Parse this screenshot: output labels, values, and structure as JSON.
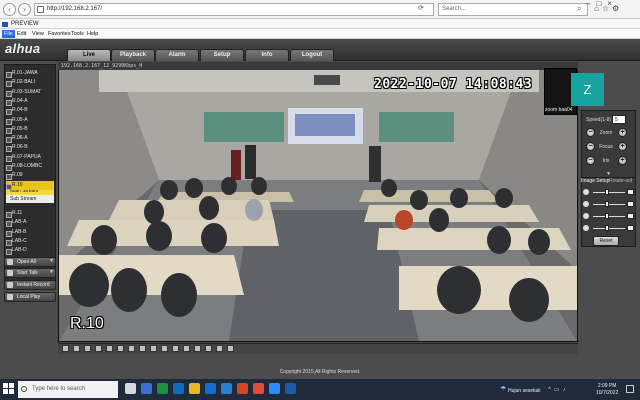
{
  "browser": {
    "url": "http://192.168.2.167/",
    "search_placeholder": "Search...",
    "tab_title": "PREVIEW",
    "menu": [
      "File",
      "Edit",
      "View",
      "Favorites",
      "Tools",
      "Help"
    ]
  },
  "app": {
    "logo": "alhua",
    "tabs": [
      "Live",
      "Playback",
      "Alarm",
      "Setup",
      "Info",
      "Logout"
    ],
    "active_tab": "Live"
  },
  "channels": [
    "R.01-JAWA",
    "R.02-BALI",
    "R.03-SUMAT",
    "R.04-A",
    "R.04-B",
    "R.05-A",
    "R.05-B",
    "R.06-A",
    "R.06-B",
    "R.07-PAPUA",
    "R.08-LOMBC",
    "R.09",
    "R.10",
    "R.11",
    "LAB-A",
    "LAB-B",
    "LAB-C",
    "LAB-D"
  ],
  "selected_channel": "R.10",
  "streams": {
    "main": "Main Stream",
    "sub": "Sub Stream"
  },
  "left_buttons": {
    "open_all": "Open All",
    "start_talk": "Start Talk",
    "instant_record": "Instant Record",
    "local_play": "Local Play"
  },
  "video": {
    "info_bar": "192.168.2.167_12_9290Kbps_H",
    "timestamp": "2022-10-07 14:08:43",
    "channel_label": "R.10"
  },
  "zoom_overlay": {
    "initial": "Z",
    "name": "zoom baa04"
  },
  "ptz": {
    "speed_label": "Speed(1-8)",
    "speed_value": "5",
    "zoom_label": "Zoom",
    "focus_label": "Focus",
    "iris_label": "Iris"
  },
  "image_setup": {
    "tab_image": "Image Setup",
    "tab_rotate": "Rotate-ool",
    "sliders": [
      0.45,
      0.45,
      0.45,
      0.45
    ],
    "reset_label": "Reset"
  },
  "footer": {
    "copyright": "Copyright 2015,All Rights Reserved."
  },
  "taskbar": {
    "search_placeholder": "Type here to search",
    "weather": "Hujan sesekali",
    "time": "2:09 PM",
    "date": "10/7/2022"
  },
  "colors": {
    "accent_yellow": "#e9c51a",
    "zoom_teal": "#17a3a0",
    "taskbar": "#1f2b3a"
  }
}
